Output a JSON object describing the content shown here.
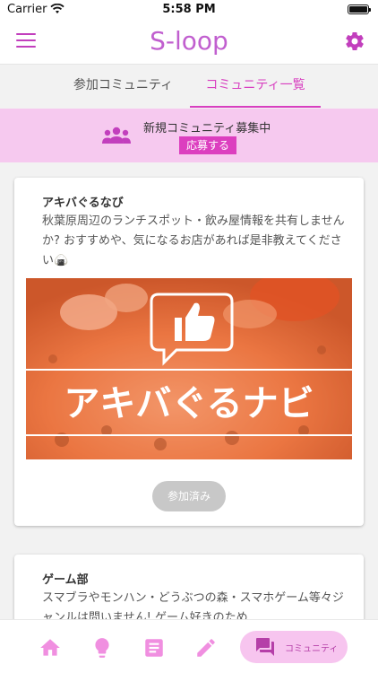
{
  "status_bar": {
    "carrier": "Carrier",
    "time": "5:58 PM"
  },
  "header": {
    "logo": "S-loop"
  },
  "tabs": [
    {
      "label": "参加コミュニティ"
    },
    {
      "label": "コミュニティ一覧"
    }
  ],
  "recruit_banner": {
    "text": "新規コミュニティ募集中",
    "button": "応募する"
  },
  "communities": [
    {
      "title": "アキバぐるなび",
      "description": "秋葉原周辺のランチスポット・飲み屋情報を共有しませんか? おすすめや、気になるお店があれば是非教えてください🍙",
      "image_text": "アキバぐるナビ",
      "button": "参加済み"
    },
    {
      "title": "ゲーム部",
      "description": "スマブラやモンハン・どうぶつの森・スマホゲーム等々ジャンルは問いません! ゲーム好きのため"
    }
  ],
  "bottom_nav": {
    "active_label": "コミュニティ"
  },
  "colors": {
    "accent": "#d83fc0",
    "banner": "#f6c9ef",
    "image_overlay": "#f0642a"
  }
}
